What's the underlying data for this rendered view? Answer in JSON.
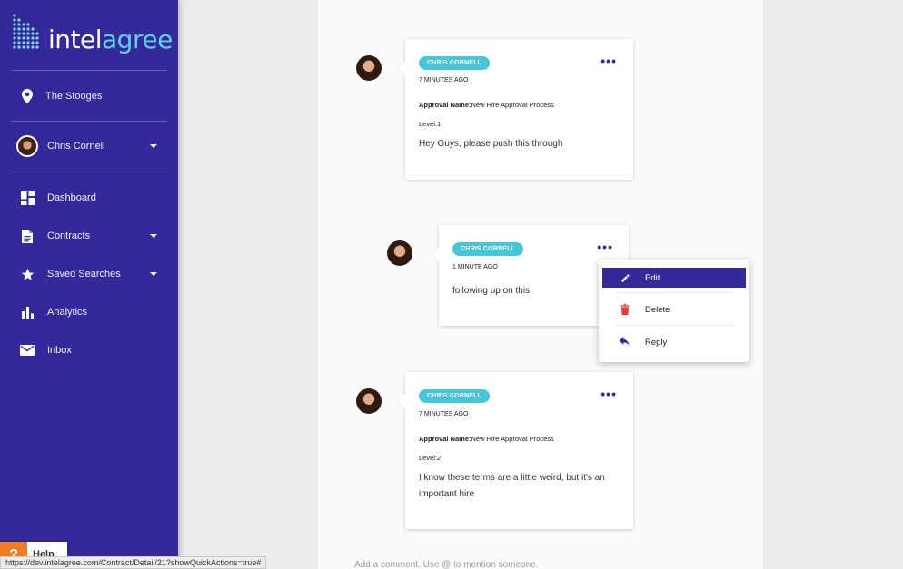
{
  "sidebar": {
    "logo": {
      "part1": "intel",
      "part2": "agree"
    },
    "location": {
      "label": "The Stooges",
      "icon": "location-pin-icon"
    },
    "user": {
      "name": "Chris Cornell"
    },
    "items": [
      {
        "label": "Dashboard",
        "icon": "dashboard-icon",
        "has_dropdown": false
      },
      {
        "label": "Contracts",
        "icon": "document-icon",
        "has_dropdown": true
      },
      {
        "label": "Saved Searches",
        "icon": "star-icon",
        "has_dropdown": true
      },
      {
        "label": "Analytics",
        "icon": "bar-chart-icon",
        "has_dropdown": false
      },
      {
        "label": "Inbox",
        "icon": "mail-icon",
        "has_dropdown": false
      }
    ]
  },
  "comments": [
    {
      "author": "CHRIS CORNELL",
      "time": "7 MINUTES AGO",
      "approval_label": "Approval Name:",
      "approval_value": "New Hire Approval Process",
      "level": "Level:1",
      "text": "Hey Guys, please push this through"
    },
    {
      "author": "CHRIS CORNELL",
      "time": "1 MINUTE AGO",
      "text": "following up on this"
    },
    {
      "author": "CHRIS CORNELL",
      "time": "7 MINUTES AGO",
      "approval_label": "Approval Name:",
      "approval_value": "New Hire Approval Process",
      "level": "Level:2",
      "text": "I know these terms are a little weird, but it's an important hire"
    }
  ],
  "more_glyph": "•••",
  "menu": {
    "items": [
      {
        "label": "Edit",
        "icon": "pencil-icon",
        "active": true
      },
      {
        "label": "Delete",
        "icon": "trash-icon",
        "active": false
      },
      {
        "label": "Reply",
        "icon": "reply-icon",
        "active": false
      }
    ]
  },
  "comment_input": {
    "placeholder": "Add a comment. Use @ to mention someone."
  },
  "help": {
    "icon_glyph": "?",
    "label": "Help"
  },
  "status_url": "https://dev.intelagree.com/Contract/Detail/21?showQuickActions=true#",
  "colors": {
    "sidebar": "#33299a",
    "badge": "#46c6d9",
    "accent": "#33299a",
    "delete": "#e53935",
    "help": "#f07c24"
  }
}
